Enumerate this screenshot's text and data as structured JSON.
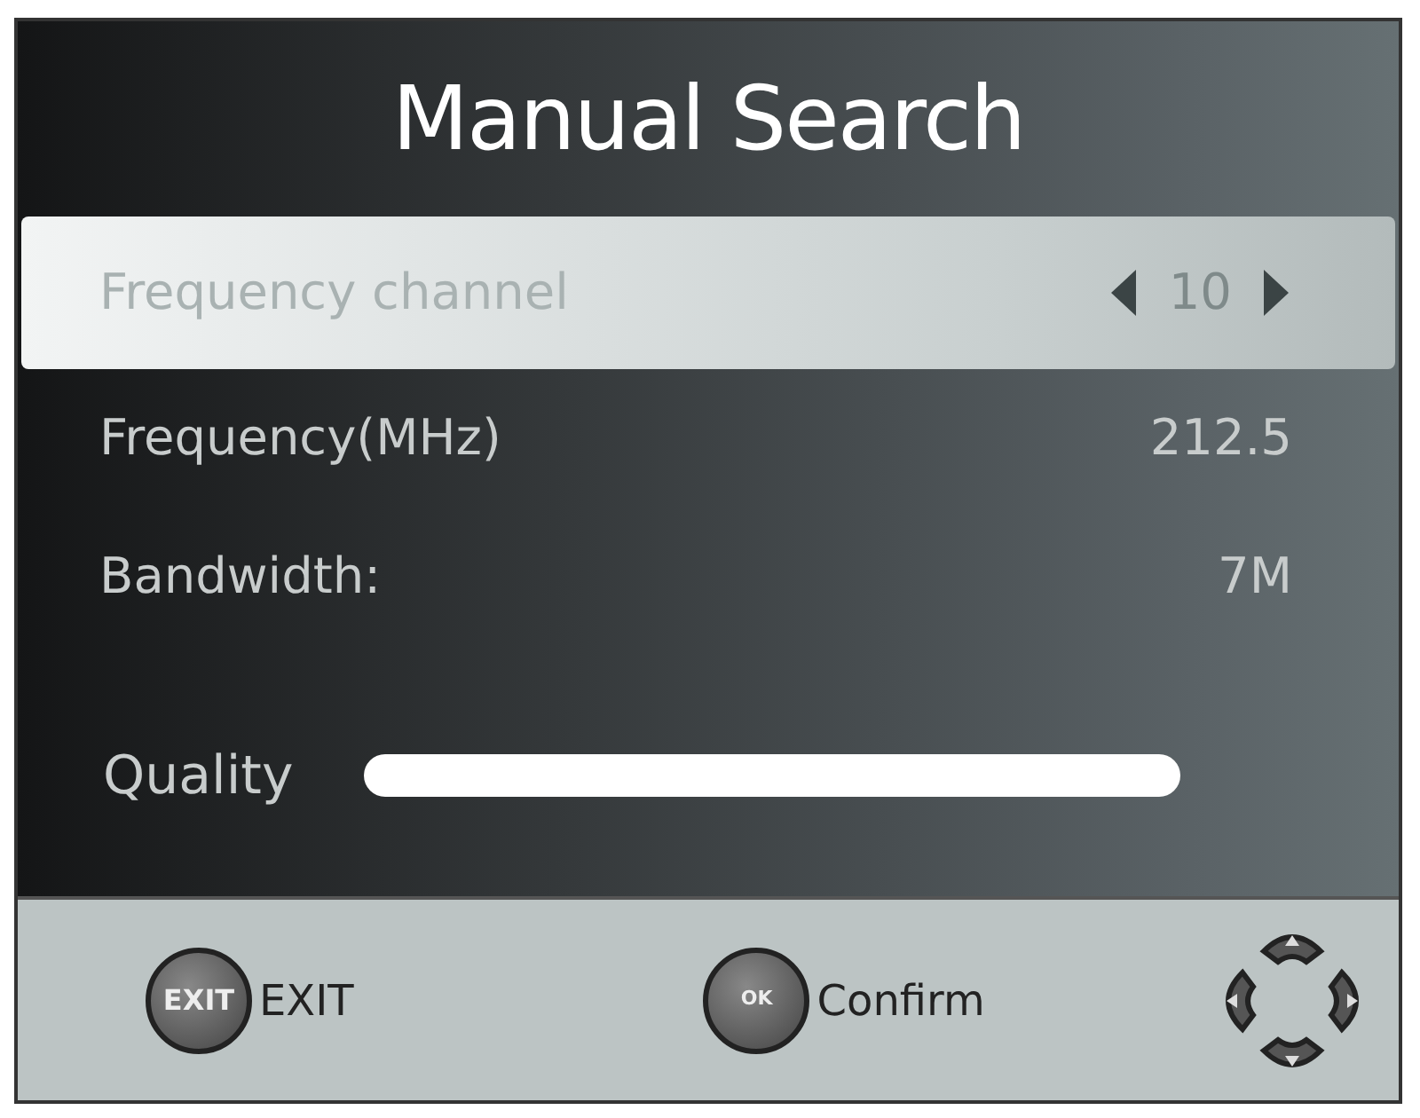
{
  "title": "Manual Search",
  "rows": [
    {
      "kind": "spinner",
      "label": "Frequency channel",
      "value": "10",
      "selected": true
    },
    {
      "kind": "value",
      "label": "Frequency(MHz)",
      "value": "212.5",
      "selected": false
    },
    {
      "kind": "value",
      "label": "Bandwidth:",
      "value": "7M",
      "selected": false
    }
  ],
  "quality": {
    "label": "Quality"
  },
  "footer": [
    {
      "kind": "key",
      "key": "EXIT",
      "label": "EXIT"
    },
    {
      "kind": "key",
      "key": "OK",
      "label": "Confirm"
    },
    {
      "kind": "dpad"
    }
  ]
}
